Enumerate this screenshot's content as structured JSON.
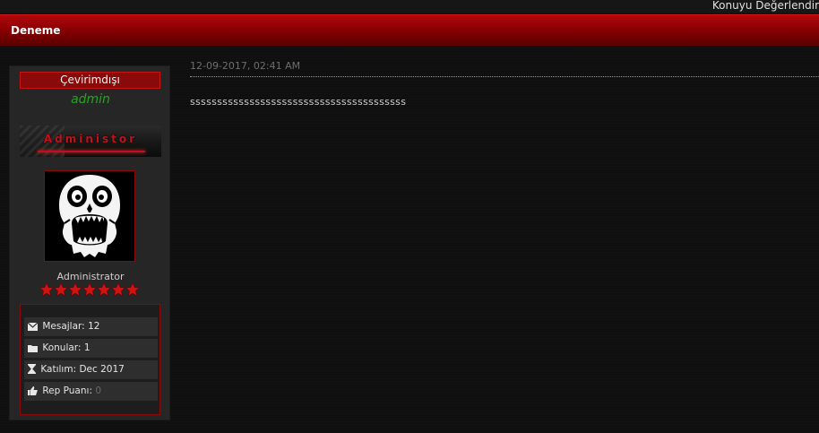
{
  "top": {
    "rate_link": "Konuyu Değerlendir"
  },
  "thread": {
    "title": "Deneme"
  },
  "author": {
    "status": "Çevirimdışı",
    "username": "admin",
    "group_banner": "Administor",
    "avatar_icon": "skull-avatar",
    "usertitle": "Administrator",
    "stars": 7,
    "stats": [
      {
        "icon": "envelope-icon",
        "label": "Mesajlar:",
        "value": "12"
      },
      {
        "icon": "folder-icon",
        "label": "Konular:",
        "value": "1"
      },
      {
        "icon": "hourglass-icon",
        "label": "Katılım:",
        "value": "Dec 2017"
      },
      {
        "icon": "thumbs-up-icon",
        "label": "Rep Puanı:",
        "value": "0"
      }
    ]
  },
  "post": {
    "date": "12-09-2017, 02:41 AM",
    "message": "ssssssssssssssssssssssssssssssssssssssss"
  },
  "colors": {
    "accent": "#8a0004",
    "username": "#27a321",
    "star": "#d11212"
  }
}
